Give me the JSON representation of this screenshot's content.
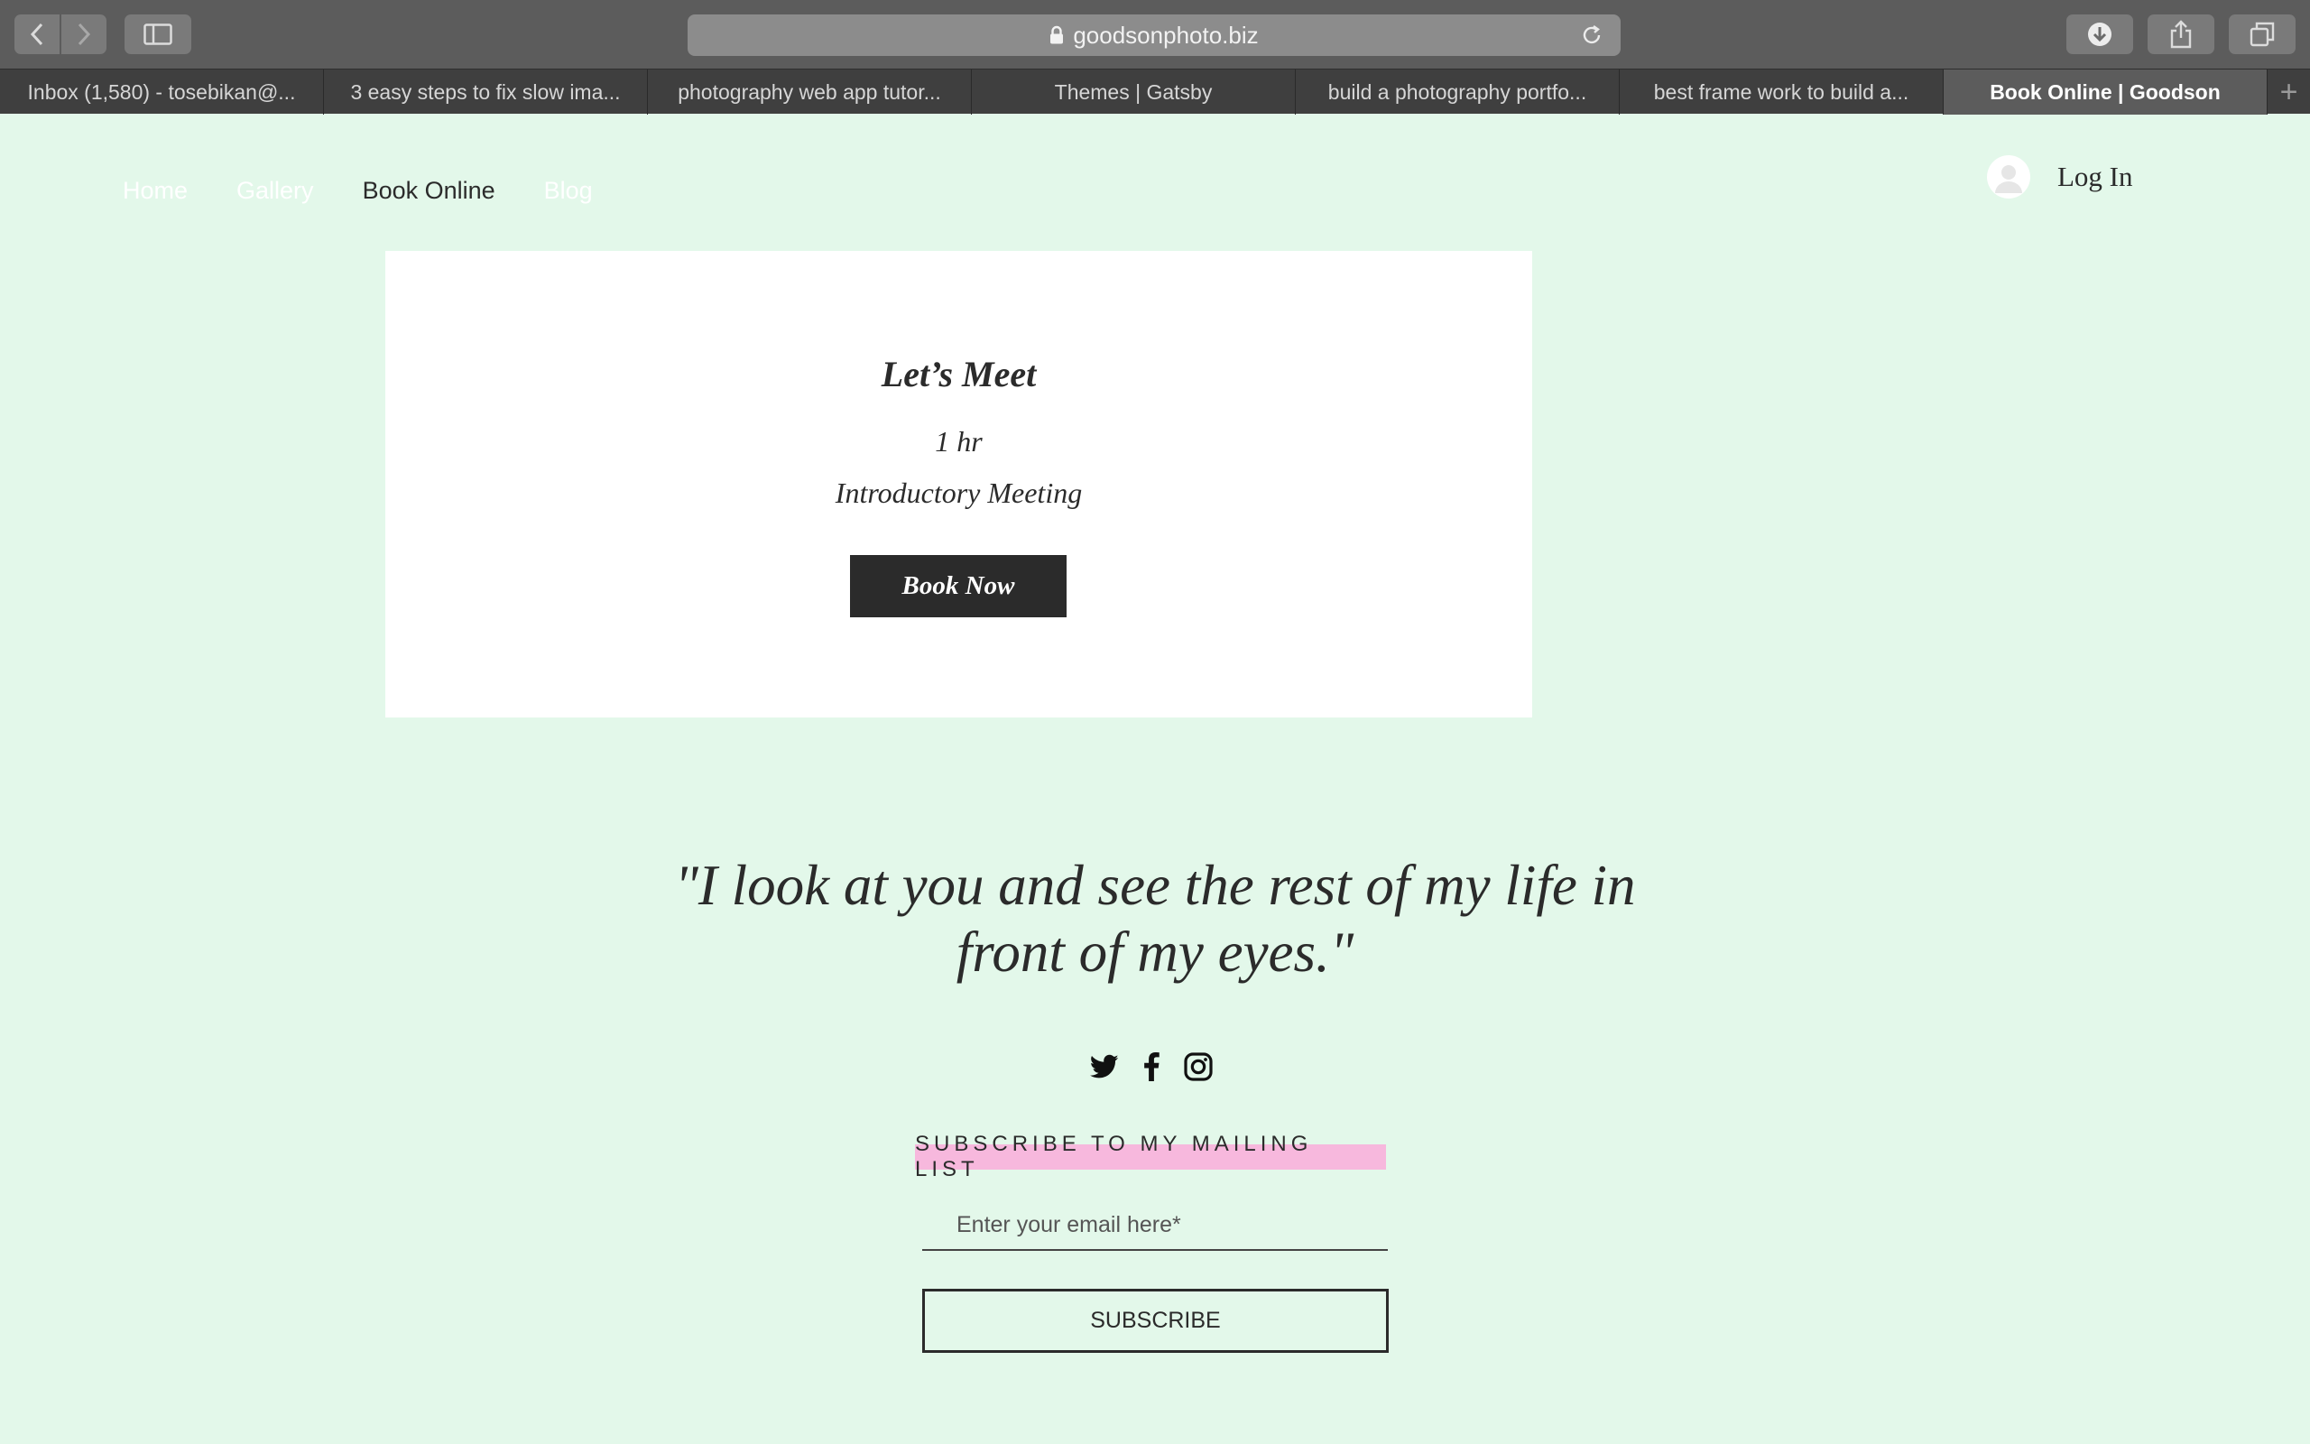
{
  "browser": {
    "address": "goodsonphoto.biz",
    "tabs": [
      {
        "label": "Inbox (1,580) - tosebikan@..."
      },
      {
        "label": "3 easy steps to fix slow ima..."
      },
      {
        "label": "photography web app tutor..."
      },
      {
        "label": "Themes | Gatsby"
      },
      {
        "label": "build a photography portfo..."
      },
      {
        "label": "best frame work to build a..."
      },
      {
        "label": "Book Online | Goodson"
      }
    ],
    "active_tab": 6,
    "new_tab": "+"
  },
  "nav": {
    "items": [
      {
        "label": "Home"
      },
      {
        "label": "Gallery"
      },
      {
        "label": "Book Online"
      },
      {
        "label": "Blog"
      }
    ],
    "current": 2
  },
  "login": {
    "label": "Log In"
  },
  "service": {
    "title": "Let’s Meet",
    "duration": "1 hr",
    "description": "Introductory Meeting",
    "cta": "Book Now"
  },
  "quote": {
    "line1": "\"I look at you and see the rest of my life in",
    "line2": "front of my eyes.\""
  },
  "social": {
    "icons": [
      "twitter-icon",
      "facebook-icon",
      "instagram-icon"
    ]
  },
  "subscribe": {
    "title": "SUBSCRIBE TO MY MAILING LIST",
    "placeholder": "Enter your email here*",
    "button": "SUBSCRIBE"
  },
  "colors": {
    "page_bg": "#e3f8ea",
    "text": "#2b2b2b",
    "highlight": "#f7b8dd",
    "button": "#2b2b2b"
  }
}
